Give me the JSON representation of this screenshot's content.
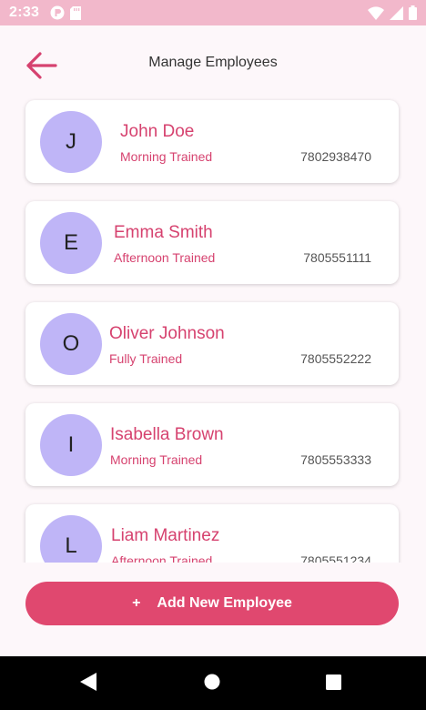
{
  "status_bar": {
    "time": "2:33"
  },
  "header": {
    "title": "Manage Employees"
  },
  "employees": [
    {
      "initial": "J",
      "name": "John Doe",
      "training": "Morning Trained",
      "phone": "7802938470"
    },
    {
      "initial": "E",
      "name": "Emma Smith",
      "training": "Afternoon Trained",
      "phone": "7805551111"
    },
    {
      "initial": "O",
      "name": "Oliver Johnson",
      "training": "Fully Trained",
      "phone": "7805552222"
    },
    {
      "initial": "I",
      "name": "Isabella Brown",
      "training": "Morning Trained",
      "phone": "7805553333"
    },
    {
      "initial": "L",
      "name": "Liam Martinez",
      "training": "Afternoon Trained",
      "phone": "7805551234"
    }
  ],
  "add_button": {
    "icon": "+",
    "label": "Add New Employee"
  },
  "colors": {
    "accent": "#e0486f",
    "name_text": "#d6426f",
    "avatar_bg": "#bfb5f7",
    "status_bar": "#f2b8cb"
  },
  "icons": {
    "back": "arrow-left-icon",
    "nav_back": "triangle-back-icon",
    "nav_home": "circle-home-icon",
    "nav_recents": "square-recents-icon"
  }
}
